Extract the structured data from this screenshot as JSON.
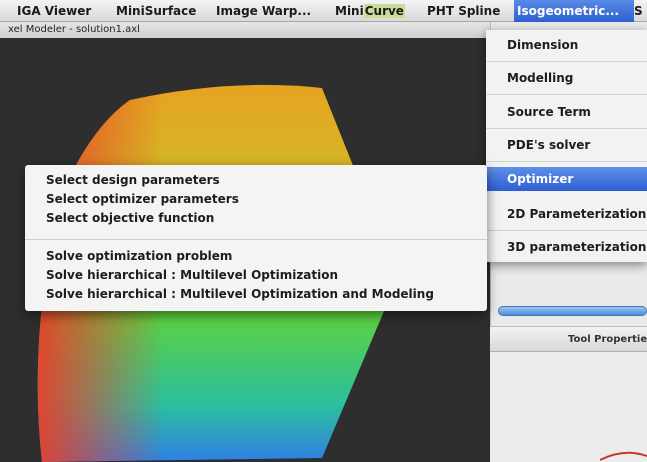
{
  "menubar": {
    "items": [
      {
        "label": "IGA Viewer"
      },
      {
        "label": "MiniSurface"
      },
      {
        "label": "Image Warp..."
      },
      {
        "label": "MiniCurve",
        "prefix": "Mini",
        "highlight": "Curve"
      },
      {
        "label": "PHT Spline"
      },
      {
        "label": "Isogeometric..."
      },
      {
        "label": "S"
      }
    ]
  },
  "window": {
    "title": "xel Modeler - solution1.axl"
  },
  "iso_menu": {
    "items": [
      {
        "label": "Dimension"
      },
      {
        "label": "Modelling"
      },
      {
        "label": "Source Term"
      },
      {
        "label": "PDE's solver"
      },
      {
        "label": "Optimizer",
        "selected": true
      },
      {
        "label": "2D Parameterization"
      },
      {
        "label": "3D parameterization"
      }
    ]
  },
  "optimizer_submenu": {
    "group1": [
      {
        "label": "Select design parameters"
      },
      {
        "label": "Select optimizer parameters"
      },
      {
        "label": "Select objective function"
      }
    ],
    "group2": [
      {
        "label": "Solve optimization problem"
      },
      {
        "label": "Solve hierarchical : Multilevel Optimization"
      },
      {
        "label": "Solve hierarchical : Multilevel Optimization and Modeling"
      }
    ]
  },
  "tool_panel": {
    "header": "Tool Properties"
  },
  "colors": {
    "menu_highlight": "#2f5fd3",
    "viewport_bg": "#2e2e2e",
    "shape_top": "#e8a41f",
    "shape_mid": "#5fd23c",
    "shape_bottom": "#2f7fe6"
  }
}
